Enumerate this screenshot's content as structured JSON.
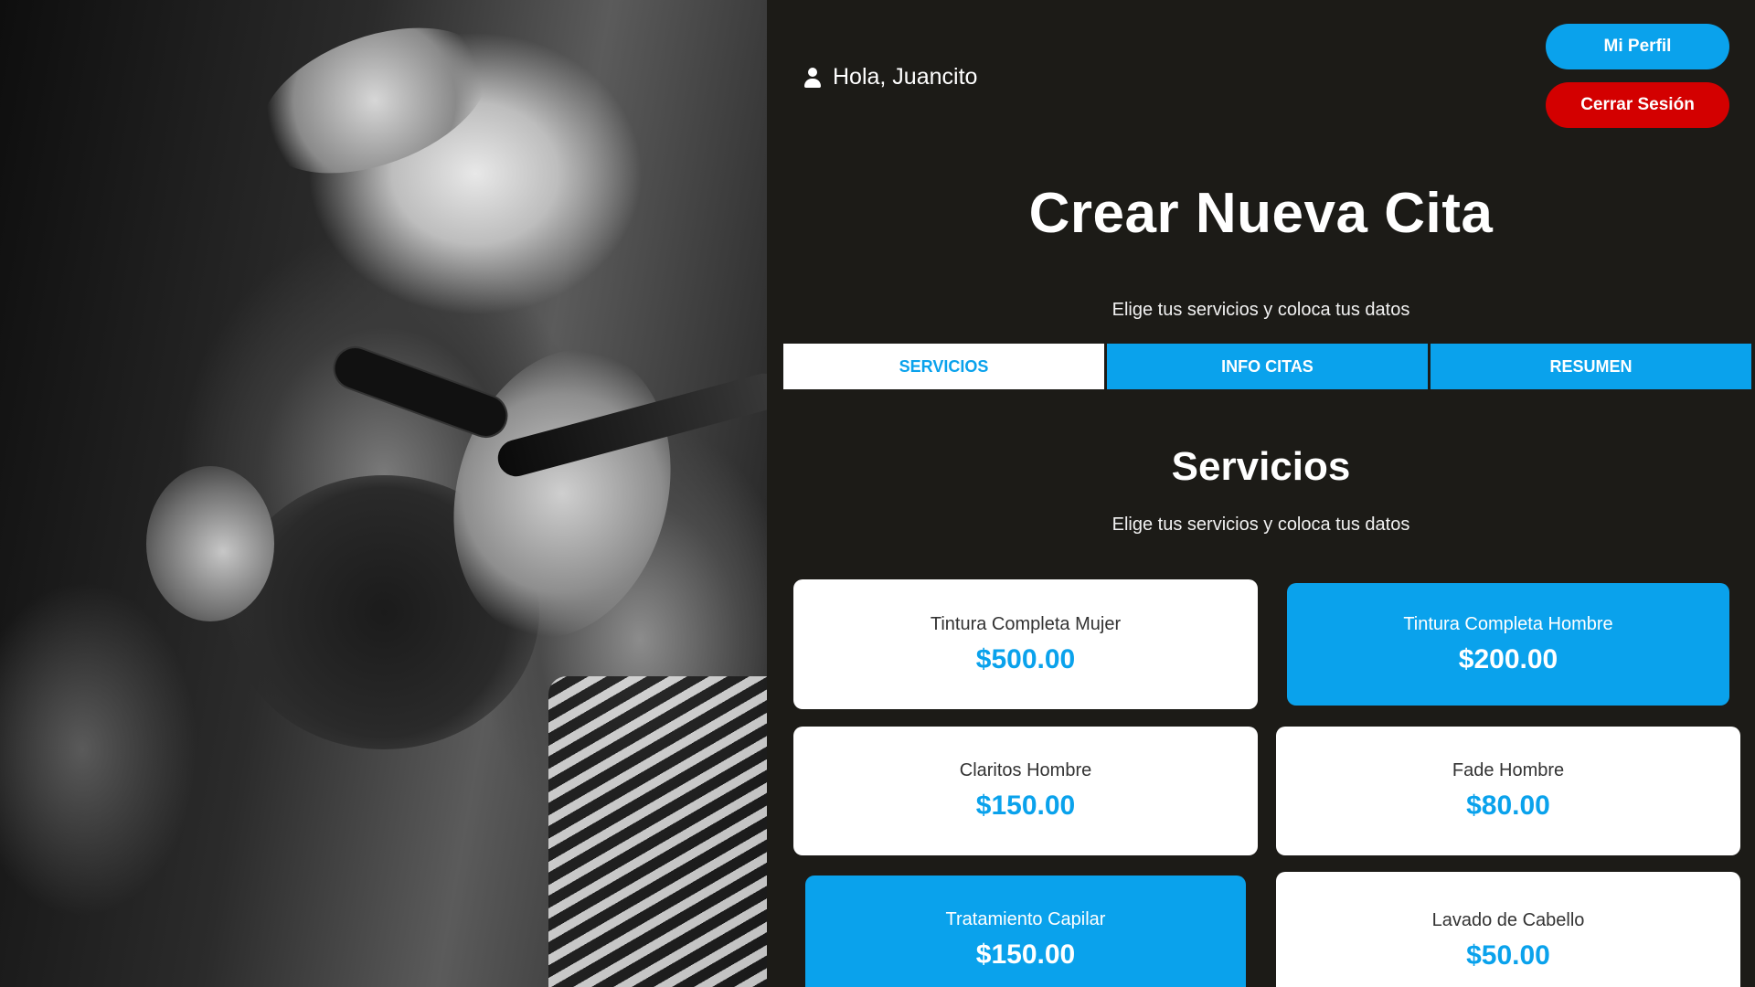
{
  "header": {
    "greeting": "Hola, Juancito",
    "profile_button": "Mi Perfil",
    "logout_button": "Cerrar Sesión"
  },
  "page": {
    "title": "Crear Nueva Cita",
    "subtitle": "Elige tus servicios y coloca tus datos"
  },
  "tabs": [
    {
      "label": "SERVICIOS",
      "active": true
    },
    {
      "label": "INFO CITAS",
      "active": false
    },
    {
      "label": "RESUMEN",
      "active": false
    }
  ],
  "services_section": {
    "title": "Servicios",
    "subtitle": "Elige tus servicios y coloca tus datos",
    "items": [
      {
        "name": "Tintura Completa Mujer",
        "price": "$500.00",
        "selected": false
      },
      {
        "name": "Tintura Completa Hombre",
        "price": "$200.00",
        "selected": true
      },
      {
        "name": "Claritos Hombre",
        "price": "$150.00",
        "selected": false
      },
      {
        "name": "Fade Hombre",
        "price": "$80.00",
        "selected": false
      },
      {
        "name": "Tratamiento Capilar",
        "price": "$150.00",
        "selected": true
      },
      {
        "name": "Lavado de Cabello",
        "price": "$50.00",
        "selected": false
      }
    ]
  },
  "colors": {
    "background": "#1c1b17",
    "accent": "#0aa2ec",
    "danger": "#d30000",
    "card": "#ffffff"
  },
  "icons": {
    "user": "user-icon"
  }
}
